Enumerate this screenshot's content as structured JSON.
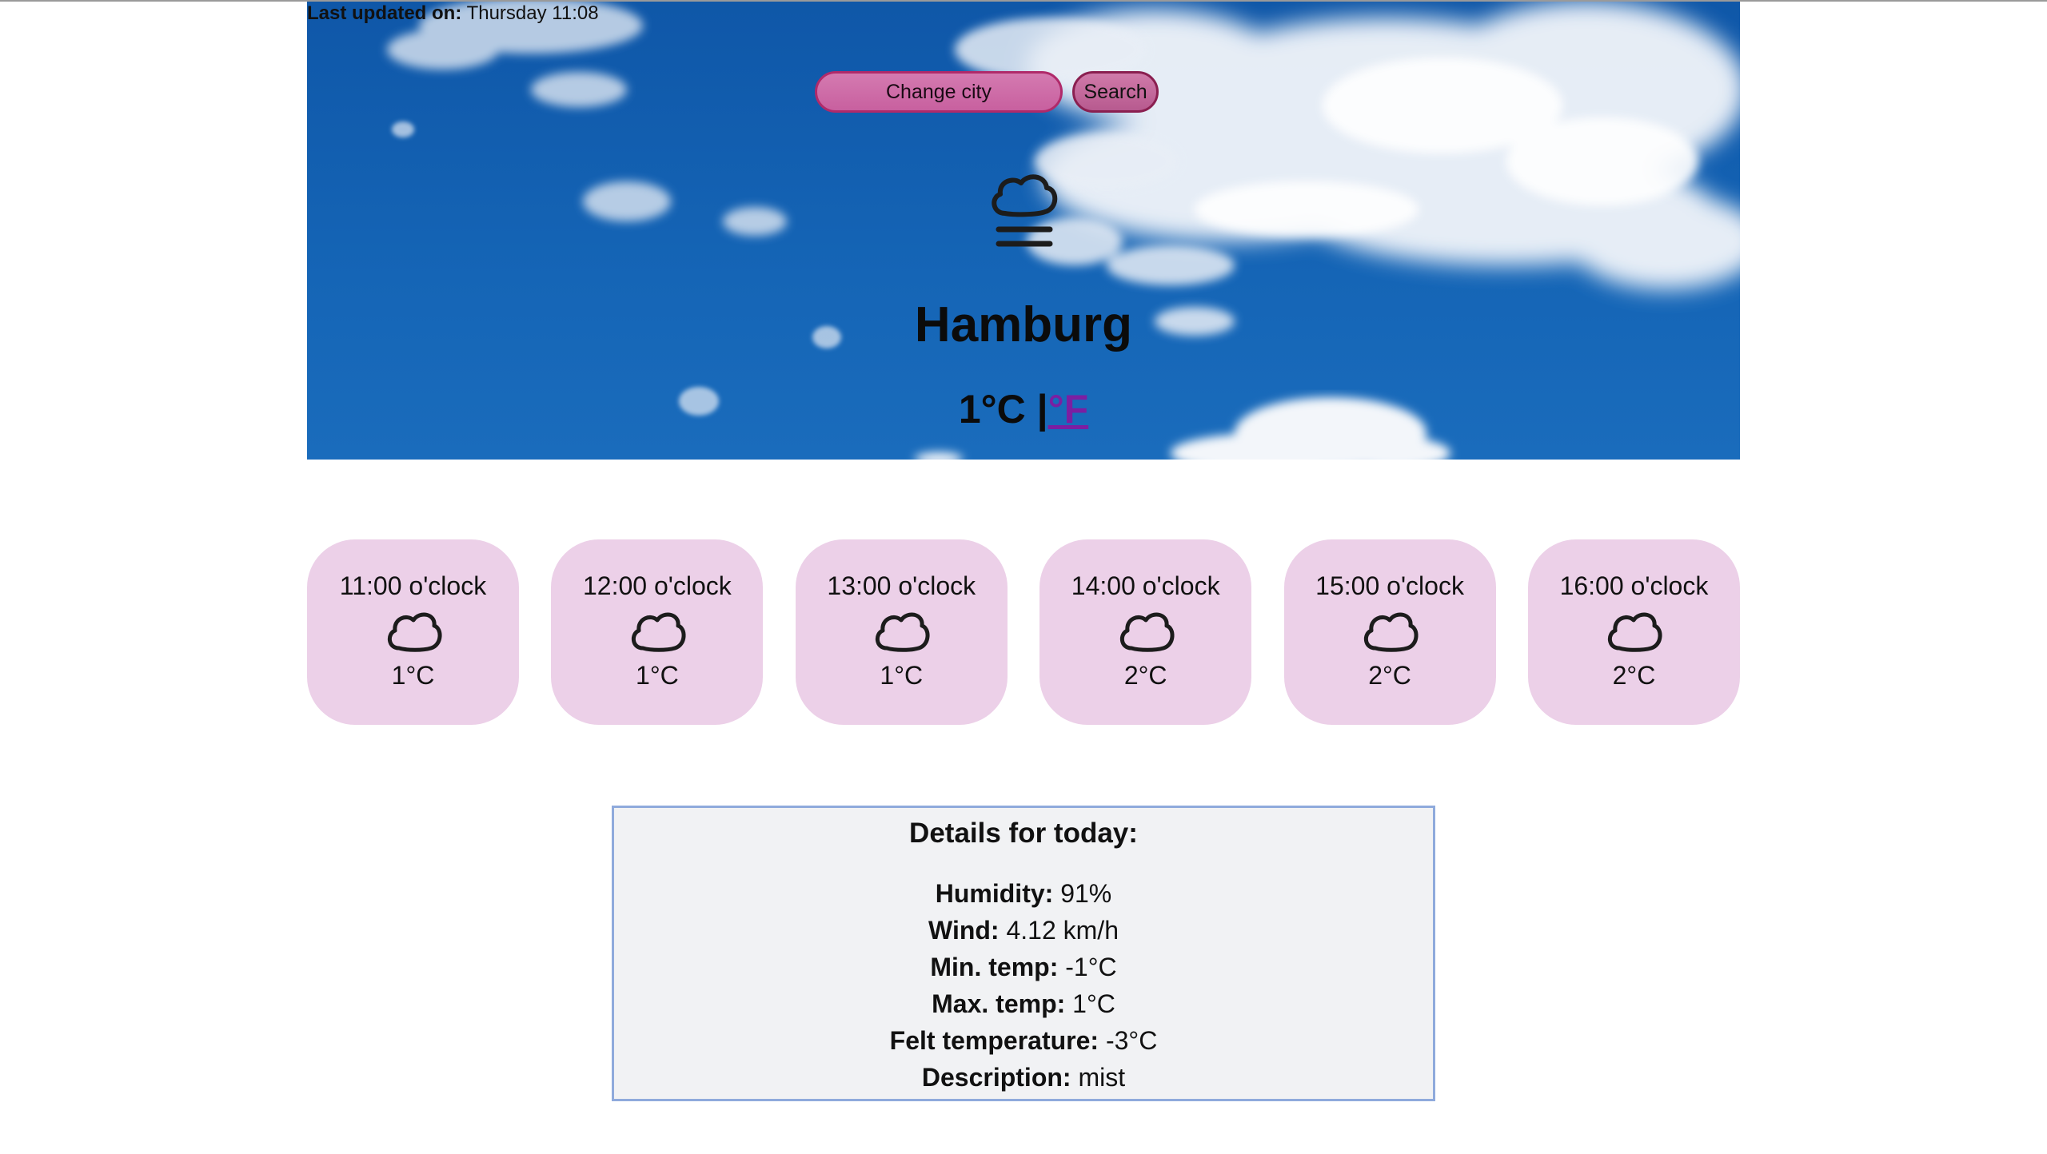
{
  "header": {
    "last_updated_label": "Last updated on:",
    "last_updated_value": "Thursday 11:08"
  },
  "search": {
    "placeholder": "Change city",
    "button_label": "Search"
  },
  "current": {
    "icon": "mist-icon",
    "city": "Hamburg",
    "temp_celsius": "1°C",
    "separator": "|",
    "fahrenheit_link": "°F"
  },
  "forecast": [
    {
      "time": "11:00 o'clock",
      "icon": "cloud-icon",
      "temp": "1°C"
    },
    {
      "time": "12:00 o'clock",
      "icon": "cloud-icon",
      "temp": "1°C"
    },
    {
      "time": "13:00 o'clock",
      "icon": "cloud-icon",
      "temp": "1°C"
    },
    {
      "time": "14:00 o'clock",
      "icon": "cloud-icon",
      "temp": "2°C"
    },
    {
      "time": "15:00 o'clock",
      "icon": "cloud-icon",
      "temp": "2°C"
    },
    {
      "time": "16:00 o'clock",
      "icon": "cloud-icon",
      "temp": "2°C"
    }
  ],
  "details": {
    "title": "Details for today:",
    "items": [
      {
        "label": "Humidity:",
        "value": "91%"
      },
      {
        "label": "Wind:",
        "value": "4.12 km/h"
      },
      {
        "label": "Min. temp:",
        "value": "-1°C"
      },
      {
        "label": "Max. temp:",
        "value": "1°C"
      },
      {
        "label": "Felt temperature:",
        "value": "-3°C"
      },
      {
        "label": "Description:",
        "value": "mist"
      }
    ]
  },
  "colors": {
    "card_background": "#ecd0e8",
    "search_accent": "#b02a6a",
    "fahrenheit_link": "#7b1fa2",
    "details_border": "#8faadc"
  }
}
